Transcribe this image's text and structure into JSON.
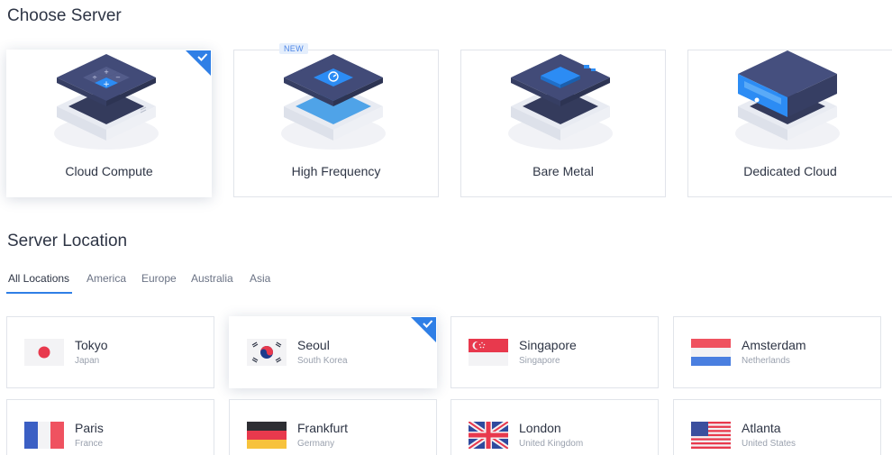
{
  "sections": {
    "server_title": "Choose Server",
    "location_title": "Server Location"
  },
  "servers": [
    {
      "label": "Cloud Compute",
      "selected": true,
      "icon": "cloud-compute-icon"
    },
    {
      "label": "High Frequency",
      "selected": false,
      "badge": "NEW",
      "icon": "high-frequency-icon"
    },
    {
      "label": "Bare Metal",
      "selected": false,
      "icon": "bare-metal-icon"
    },
    {
      "label": "Dedicated Cloud",
      "selected": false,
      "icon": "dedicated-cloud-icon"
    }
  ],
  "tabs": [
    {
      "label": "All Locations",
      "active": true
    },
    {
      "label": "America",
      "active": false
    },
    {
      "label": "Europe",
      "active": false
    },
    {
      "label": "Australia",
      "active": false
    },
    {
      "label": "Asia",
      "active": false
    }
  ],
  "locations": [
    {
      "city": "Tokyo",
      "country": "Japan",
      "flag": "japan-flag-icon",
      "selected": false
    },
    {
      "city": "Seoul",
      "country": "South Korea",
      "flag": "south-korea-flag-icon",
      "selected": true
    },
    {
      "city": "Singapore",
      "country": "Singapore",
      "flag": "singapore-flag-icon",
      "selected": false
    },
    {
      "city": "Amsterdam",
      "country": "Netherlands",
      "flag": "netherlands-flag-icon",
      "selected": false
    },
    {
      "city": "Paris",
      "country": "France",
      "flag": "france-flag-icon",
      "selected": false
    },
    {
      "city": "Frankfurt",
      "country": "Germany",
      "flag": "germany-flag-icon",
      "selected": false
    },
    {
      "city": "London",
      "country": "United Kingdom",
      "flag": "uk-flag-icon",
      "selected": false
    },
    {
      "city": "Atlanta",
      "country": "United States",
      "flag": "usa-flag-icon",
      "selected": false
    }
  ],
  "colors": {
    "accent": "#2f7fe6",
    "text": "#2e3545",
    "muted": "#9aa1ae",
    "border": "#e1e4ea",
    "server_dark": "#3f4a73",
    "server_blue": "#2c8cf4"
  }
}
